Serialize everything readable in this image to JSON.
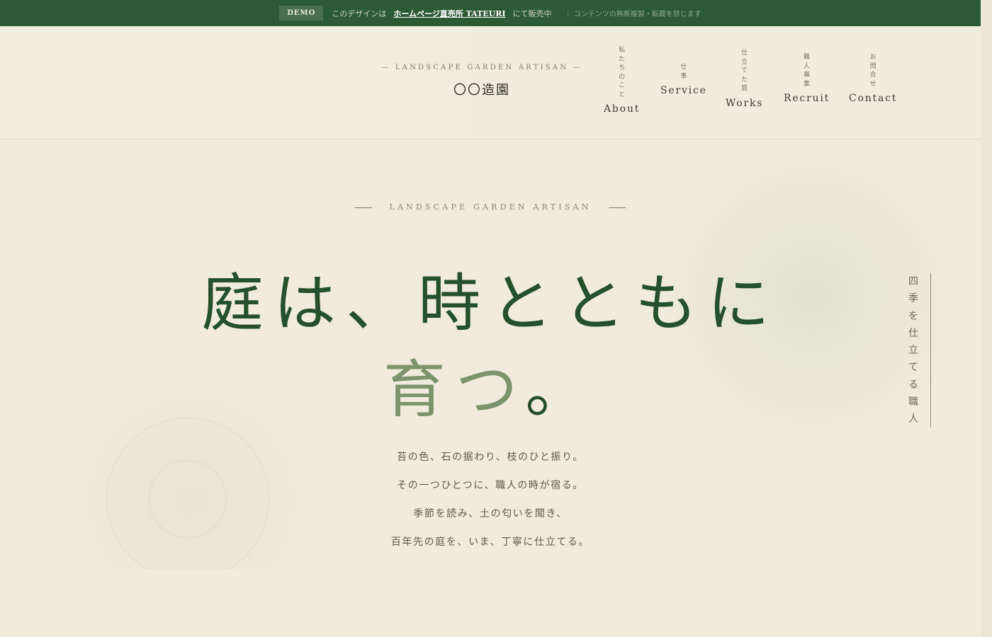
{
  "topbar": {
    "badge": "DEMO",
    "prefix": "このデザインは",
    "link": "ホームページ直売所 TATEURI",
    "suffix": "にて販売中",
    "notice": "｜ コンテンツの無断複製・転載を禁じます"
  },
  "header": {
    "tagline": "— LANDSCAPE GARDEN ARTISAN —",
    "brand_name": "〇〇造園",
    "nav": [
      {
        "jp": "私たちのこと",
        "en": "About"
      },
      {
        "jp": "仕事",
        "en": "Service"
      },
      {
        "jp": "仕立てた庭",
        "en": "Works"
      },
      {
        "jp": "職人募集",
        "en": "Recruit"
      },
      {
        "jp": "お問合せ",
        "en": "Contact"
      }
    ]
  },
  "hero": {
    "eyebrow": "LANDSCAPE GARDEN ARTISAN",
    "headline_line1": "庭は、時とともに",
    "headline_line2_accent": "育つ",
    "headline_line2_end": "。",
    "paragraph": [
      "苔の色、石の据わり、枝のひと振り。",
      "その一つひとつに、職人の時が宿る。",
      "季節を読み、土の匂いを聞き、",
      "百年先の庭を、いま、丁寧に仕立てる。"
    ],
    "vertical_text": "四季を仕立てる職人"
  },
  "colors": {
    "topbar": "#2b5a35",
    "background": "#f0ebdc",
    "headline": "#24502c",
    "accent": "#7c936b"
  }
}
